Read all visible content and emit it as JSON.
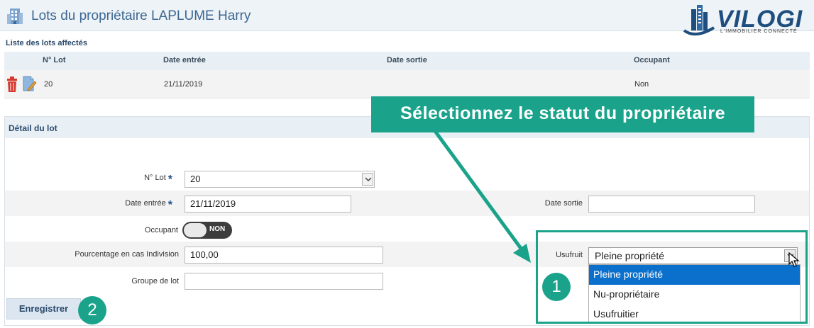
{
  "header": {
    "title": "Lots du propriétaire LAPLUME Harry",
    "logo_text": "VILOGI",
    "logo_tagline": "L'IMMOBILIER CONNECTÉ"
  },
  "lots_list": {
    "label": "Liste des lots affectés",
    "columns": [
      "N° Lot",
      "Date entrée",
      "Date sortie",
      "Occupant"
    ],
    "rows": [
      {
        "lot": "20",
        "date_entree": "21/11/2019",
        "date_sortie": "",
        "occupant": "Non"
      }
    ]
  },
  "detail": {
    "title": "Détail du lot",
    "lot_label": "N° Lot",
    "lot_value": "20",
    "date_entree_label": "Date entrée",
    "date_entree_value": "21/11/2019",
    "date_sortie_label": "Date sortie",
    "date_sortie_value": "",
    "occupant_label": "Occupant",
    "occupant_toggle": "NON",
    "pourcentage_label": "Pourcentage en cas Indivision",
    "pourcentage_value": "100,00",
    "groupe_label": "Groupe de lot",
    "groupe_value": "",
    "required_mark": "*",
    "save_label": "Enregistrer"
  },
  "usufruit": {
    "label": "Usufruit",
    "selected": "Pleine propriété",
    "options": [
      "Pleine propriété",
      "Nu-propriétaire",
      "Usufruitier"
    ]
  },
  "annotation": {
    "callout": "Sélectionnez le statut du propriétaire",
    "step1": "1",
    "step2": "2"
  },
  "colors": {
    "accent": "#1aa38a",
    "title": "#3d6792",
    "selection": "#0b6fcc",
    "delete": "#d43a2f"
  }
}
